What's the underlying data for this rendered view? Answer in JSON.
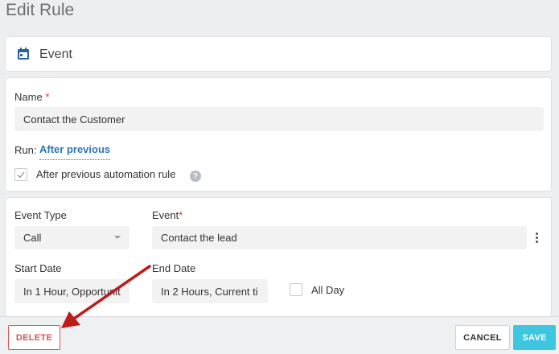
{
  "page": {
    "title": "Edit Rule"
  },
  "event_section": {
    "icon": "calendar-icon",
    "label": "Event"
  },
  "rule": {
    "name_label": "Name",
    "required_mark": "*",
    "name_value": "Contact the Customer",
    "run_label": "Run:",
    "run_value": "After previous",
    "after_previous_label": "After previous automation rule",
    "after_previous_checked": true,
    "help_glyph": "?"
  },
  "details": {
    "event_type_label": "Event Type",
    "event_type_value": "Call",
    "event_label": "Event",
    "event_value": "Contact the lead",
    "start_date_label": "Start Date",
    "start_date_value": "In 1 Hour, Opportunit",
    "end_date_label": "End Date",
    "end_date_value": "In 2 Hours, Current ti",
    "all_day_label": "All Day",
    "all_day_checked": false
  },
  "footer": {
    "delete_label": "DELETE",
    "cancel_label": "CANCEL",
    "save_label": "SAVE"
  },
  "colors": {
    "accent_link": "#2a77b8",
    "save_button": "#3ec6e0",
    "delete_border": "#d9534f",
    "annotation_arrow": "#c01b1b"
  }
}
